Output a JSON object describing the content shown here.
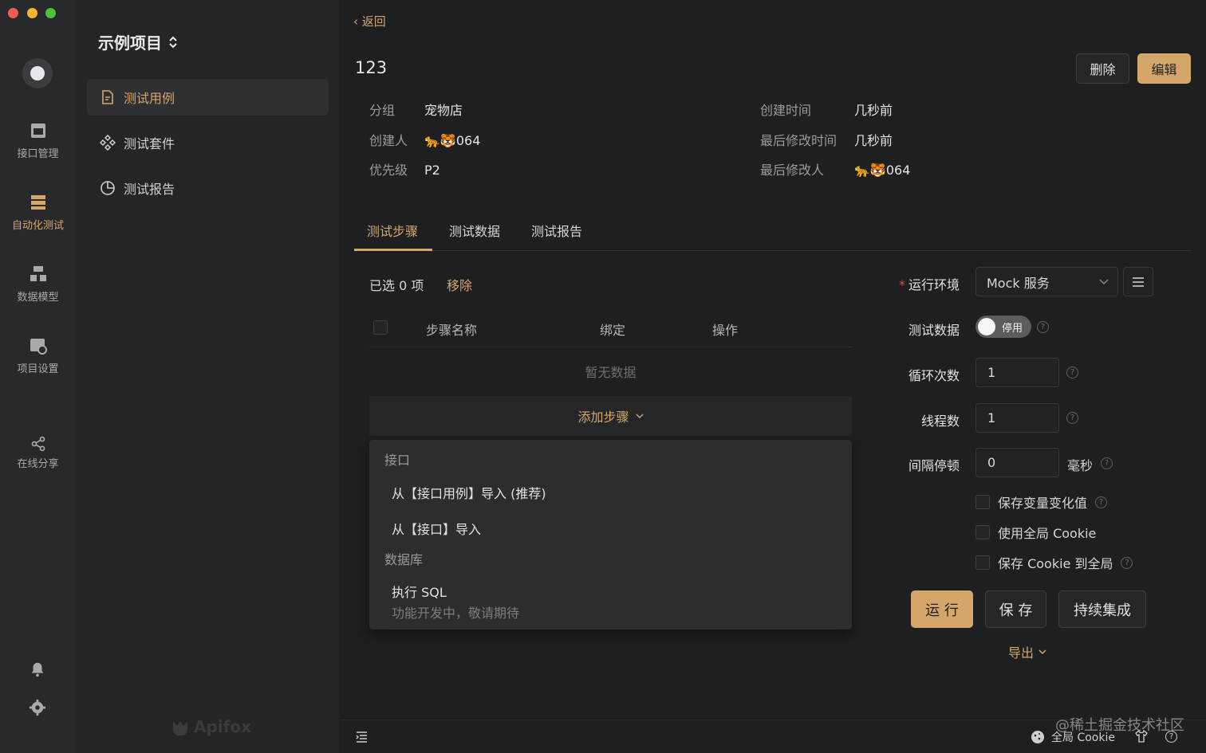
{
  "rail": {
    "items": [
      {
        "label": "接口管理",
        "icon": "api-icon"
      },
      {
        "label": "自动化测试",
        "icon": "automation-icon"
      },
      {
        "label": "数据模型",
        "icon": "data-model-icon"
      },
      {
        "label": "项目设置",
        "icon": "project-settings-icon"
      },
      {
        "label": "在线分享",
        "icon": "share-icon"
      }
    ]
  },
  "sidebar": {
    "project_title": "示例项目",
    "items": [
      {
        "label": "测试用例",
        "icon": "file-icon"
      },
      {
        "label": "测试套件",
        "icon": "suite-icon"
      },
      {
        "label": "测试报告",
        "icon": "pie-chart-icon"
      }
    ],
    "brand": "Apifox"
  },
  "header": {
    "back_label": "返回",
    "title": "123",
    "delete_label": "删除",
    "edit_label": "编辑"
  },
  "meta": {
    "group_label": "分组",
    "group_value": "宠物店",
    "creator_label": "创建人",
    "creator_value": "🐆🐯064",
    "priority_label": "优先级",
    "priority_value": "P2",
    "created_label": "创建时间",
    "created_value": "几秒前",
    "modified_label": "最后修改时间",
    "modified_value": "几秒前",
    "modifier_label": "最后修改人",
    "modifier_value": "🐆🐯064"
  },
  "tabs": [
    {
      "label": "测试步骤"
    },
    {
      "label": "测试数据"
    },
    {
      "label": "测试报告"
    }
  ],
  "steps": {
    "selected_text": "已选 0 项",
    "remove_label": "移除",
    "columns": [
      "步骤名称",
      "绑定",
      "操作"
    ],
    "empty_text": "暂无数据",
    "add_label": "添加步骤"
  },
  "dropdown": {
    "group1": "接口",
    "item1": "从【接口用例】导入 (推荐)",
    "item2": "从【接口】导入",
    "group2": "数据库",
    "item3": "执行 SQL",
    "item3_note": "功能开发中，敬请期待"
  },
  "settings": {
    "env_label": "运行环境",
    "env_value": "Mock 服务",
    "data_label": "测试数据",
    "data_toggle": "停用",
    "loop_label": "循环次数",
    "loop_value": "1",
    "thread_label": "线程数",
    "thread_value": "1",
    "interval_label": "间隔停顿",
    "interval_value": "0",
    "interval_unit": "毫秒",
    "save_var_label": "保存变量变化值",
    "global_cookie_label": "使用全局 Cookie",
    "save_cookie_label": "保存 Cookie 到全局",
    "run_label": "运 行",
    "save_label": "保 存",
    "ci_label": "持续集成",
    "export_label": "导出"
  },
  "footer": {
    "cookie_label": "全局 Cookie",
    "watermark": "@稀土掘金技术社区"
  },
  "colors": {
    "accent": "#d5a66a",
    "background": "#1e1f21"
  }
}
